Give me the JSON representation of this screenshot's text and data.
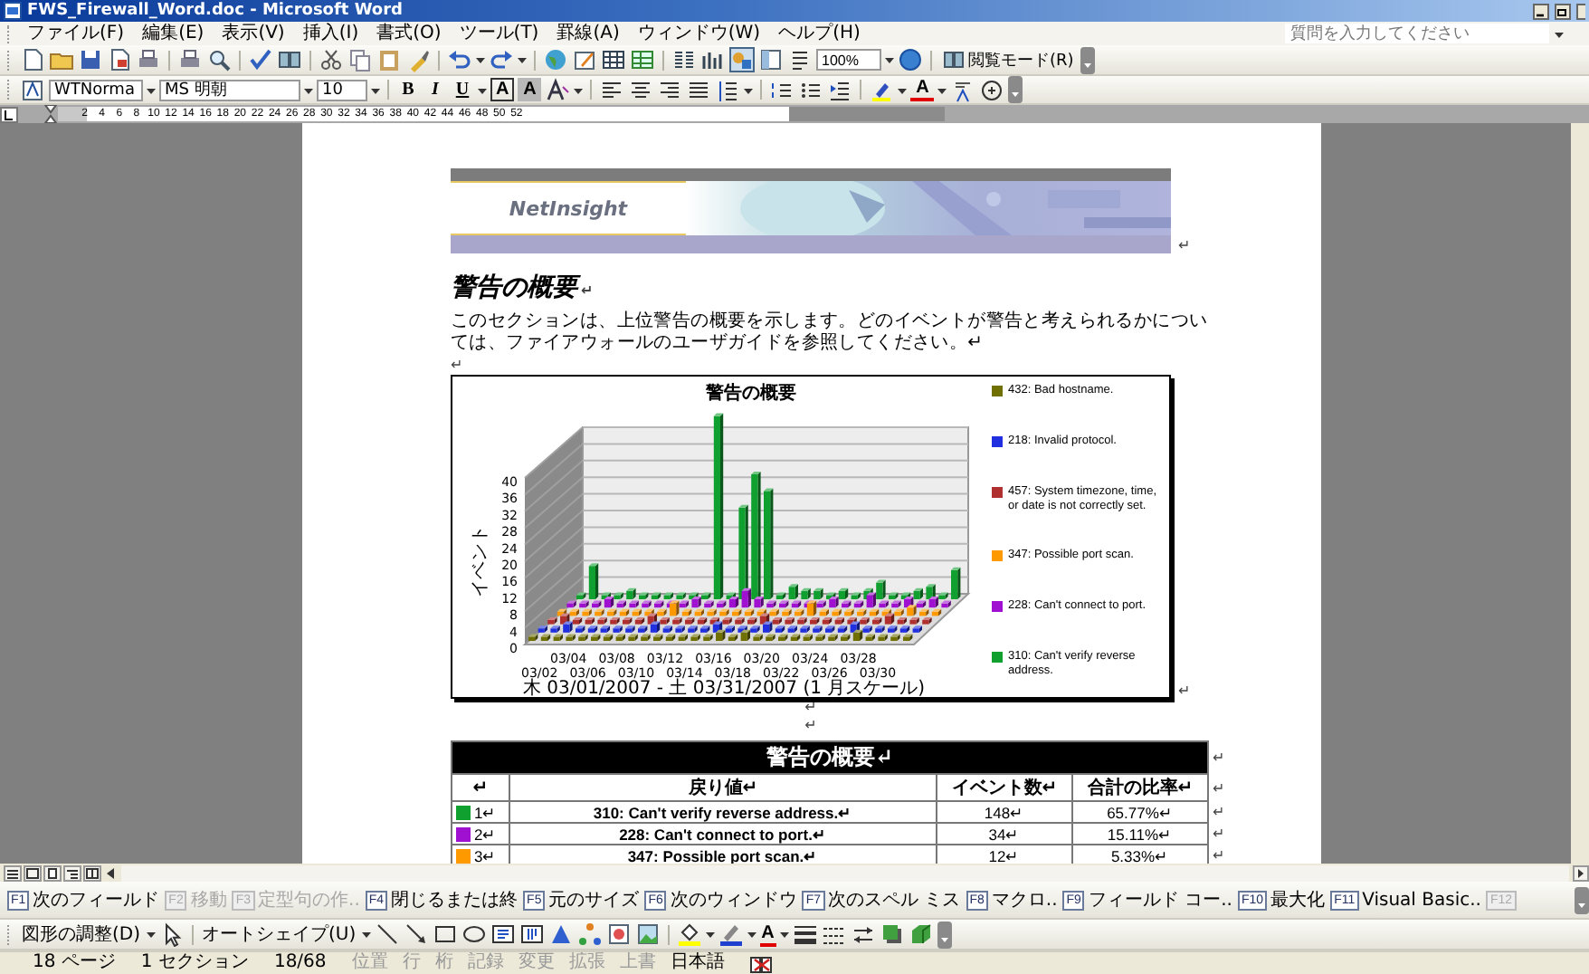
{
  "window": {
    "title": "FWS_Firewall_Word.doc - Microsoft Word"
  },
  "menu": [
    {
      "label": "ファイル(F)"
    },
    {
      "label": "編集(E)"
    },
    {
      "label": "表示(V)"
    },
    {
      "label": "挿入(I)"
    },
    {
      "label": "書式(O)"
    },
    {
      "label": "ツール(T)"
    },
    {
      "label": "罫線(A)"
    },
    {
      "label": "ウィンドウ(W)"
    },
    {
      "label": "ヘルプ(H)"
    }
  ],
  "help_box": {
    "placeholder": "質問を入力してください"
  },
  "standard_toolbar": {
    "zoom": "100%",
    "reading_mode": "閲覧モード(R)"
  },
  "format_toolbar": {
    "style": "WTNorma",
    "font": "MS 明朝",
    "size": "10",
    "buttons": [
      {
        "label": "B",
        "kind": "bold"
      },
      {
        "label": "I",
        "kind": "italic"
      },
      {
        "label": "U",
        "kind": "underline"
      },
      {
        "label": "A",
        "kind": "border"
      },
      {
        "label": "A",
        "kind": "shade"
      }
    ],
    "font_color": "A"
  },
  "ruler": {
    "numbers": [
      "2",
      "4",
      "6",
      "8",
      "10",
      "12",
      "14",
      "16",
      "18",
      "20",
      "22",
      "24",
      "26",
      "28",
      "30",
      "32",
      "34",
      "36",
      "38",
      "40",
      "42",
      "44",
      "46",
      "48",
      "50",
      "52"
    ]
  },
  "document": {
    "logo": "NetInsight",
    "banner_mark": "↵",
    "heading": "警告の概要",
    "heading_mark": "↵",
    "paragraph": "このセクションは、上位警告の概要を示します。どのイベントが警告と考えられるかについては、ファイアウォールのユーザガイドを参照してください。↵",
    "empty_mark": "↵",
    "chart": {
      "title": "警告の概要",
      "ylabel": "イベント",
      "xlabel": "木 03/01/2007 - 土 03/31/2007 (1 月スケール)",
      "yticks": [
        "40",
        "36",
        "32",
        "28",
        "24",
        "20",
        "16",
        "12",
        "8",
        "4",
        "0"
      ],
      "x_labels_top": [
        "03/04",
        "03/08",
        "03/12",
        "03/16",
        "03/20",
        "03/24",
        "03/28"
      ],
      "x_labels_bottom": [
        "03/02",
        "03/06",
        "03/10",
        "03/14",
        "03/18",
        "03/22",
        "03/26",
        "03/30"
      ],
      "legend": [
        {
          "label": "432: Bad hostname.",
          "color": "#707000"
        },
        {
          "label": "218: Invalid protocol.",
          "color": "#2030e0"
        },
        {
          "label": "457: System timezone, time, or date is not correctly set.",
          "color": "#b03030"
        },
        {
          "label": "347: Possible port scan.",
          "color": "#ff9900"
        },
        {
          "label": "228: Can't connect to port.",
          "color": "#a010d0"
        },
        {
          "label": "310: Can't verify reverse address.",
          "color": "#10a030"
        }
      ]
    },
    "chart_mark": "↵",
    "after_chart_marks": [
      "↵",
      "↵"
    ],
    "table": {
      "title": "警告の概要↵",
      "title_end_mark": "↵",
      "columns": [
        "↵",
        "戻り値↵",
        "イベント数↵",
        "合計の比率↵"
      ],
      "header_end_mark": "↵",
      "rows": [
        {
          "rank": "1↵",
          "color": "#10a030",
          "value": "310: Can't verify reverse address.↵",
          "events": "148↵",
          "ratio": "65.77%↵",
          "end_mark": "↵"
        },
        {
          "rank": "2↵",
          "color": "#a010d0",
          "value": "228: Can't connect to port.↵",
          "events": "34↵",
          "ratio": "15.11%↵",
          "end_mark": "↵"
        },
        {
          "rank": "3↵",
          "color": "#ff9900",
          "value": "347: Possible port scan.↵",
          "events": "12↵",
          "ratio": "5.33%↵",
          "end_mark": "↵"
        }
      ]
    }
  },
  "fkeys": [
    {
      "key": "F1",
      "label": "次のフィールド",
      "disabled": false
    },
    {
      "key": "F2",
      "label": "移動",
      "disabled": true
    },
    {
      "key": "F3",
      "label": "定型句の作..",
      "disabled": true
    },
    {
      "key": "F4",
      "label": "閉じるまたは終",
      "disabled": false
    },
    {
      "key": "F5",
      "label": "元のサイズ",
      "disabled": false
    },
    {
      "key": "F6",
      "label": "次のウィンドウ",
      "disabled": false
    },
    {
      "key": "F7",
      "label": "次のスペル ミス",
      "disabled": false
    },
    {
      "key": "F8",
      "label": "マクロ..",
      "disabled": false
    },
    {
      "key": "F9",
      "label": "フィールド コー..",
      "disabled": false
    },
    {
      "key": "F10",
      "label": "最大化",
      "disabled": false
    },
    {
      "key": "F11",
      "label": "Visual Basic..",
      "disabled": false
    },
    {
      "key": "F12",
      "disabled": true
    }
  ],
  "drawing_toolbar": {
    "adjust": "図形の調整(D)",
    "autoshape": "オートシェイプ(U)",
    "font_color": "A"
  },
  "status_bar": [
    {
      "text": "18 ページ",
      "disabled": false
    },
    {
      "text": "1 セクション",
      "disabled": false
    },
    {
      "text": "18/68",
      "disabled": false
    },
    {
      "text": "位置",
      "disabled": true
    },
    {
      "text": "行",
      "disabled": true
    },
    {
      "text": "桁",
      "disabled": true
    },
    {
      "text": "記録",
      "disabled": true
    },
    {
      "text": "変更",
      "disabled": true
    },
    {
      "text": "拡張",
      "disabled": true
    },
    {
      "text": "上書",
      "disabled": true
    },
    {
      "text": "日本語",
      "disabled": false
    }
  ]
}
